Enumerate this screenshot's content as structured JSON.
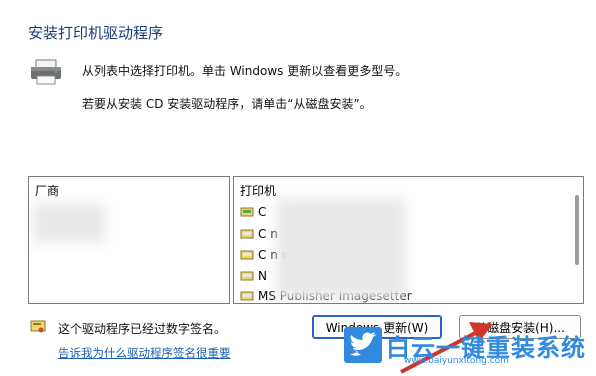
{
  "dialog": {
    "title": "安装打印机驱动程序",
    "instruction": "从列表中选择打印机。单击 Windows 更新以查看更多型号。",
    "cd_instruction": "若要从安装 CD 安装驱动程序，请单击“从磁盘安装”。"
  },
  "manufacturer_list": {
    "header": "厂商"
  },
  "printer_list": {
    "header": "打印机",
    "items": [
      {
        "label": "C"
      },
      {
        "label": "C                              n"
      },
      {
        "label": "C                              n wide"
      },
      {
        "label": "N"
      },
      {
        "label": "MS Publisher Imagesetter"
      }
    ]
  },
  "signature": {
    "status": "这个驱动程序已经过数字签名。",
    "link": "告诉我为什么驱动程序签名很重要"
  },
  "buttons": {
    "windows_update": "Windows 更新(W)",
    "have_disk": "从磁盘安装(H)..."
  },
  "watermark": {
    "text": "白云一键重装系统",
    "url": "www.baiyunxitong.com"
  },
  "colors": {
    "accent": "#2a62c9",
    "title": "#1a3d7c",
    "link": "#1a5fb4",
    "watermark": "#2f8ae0"
  }
}
